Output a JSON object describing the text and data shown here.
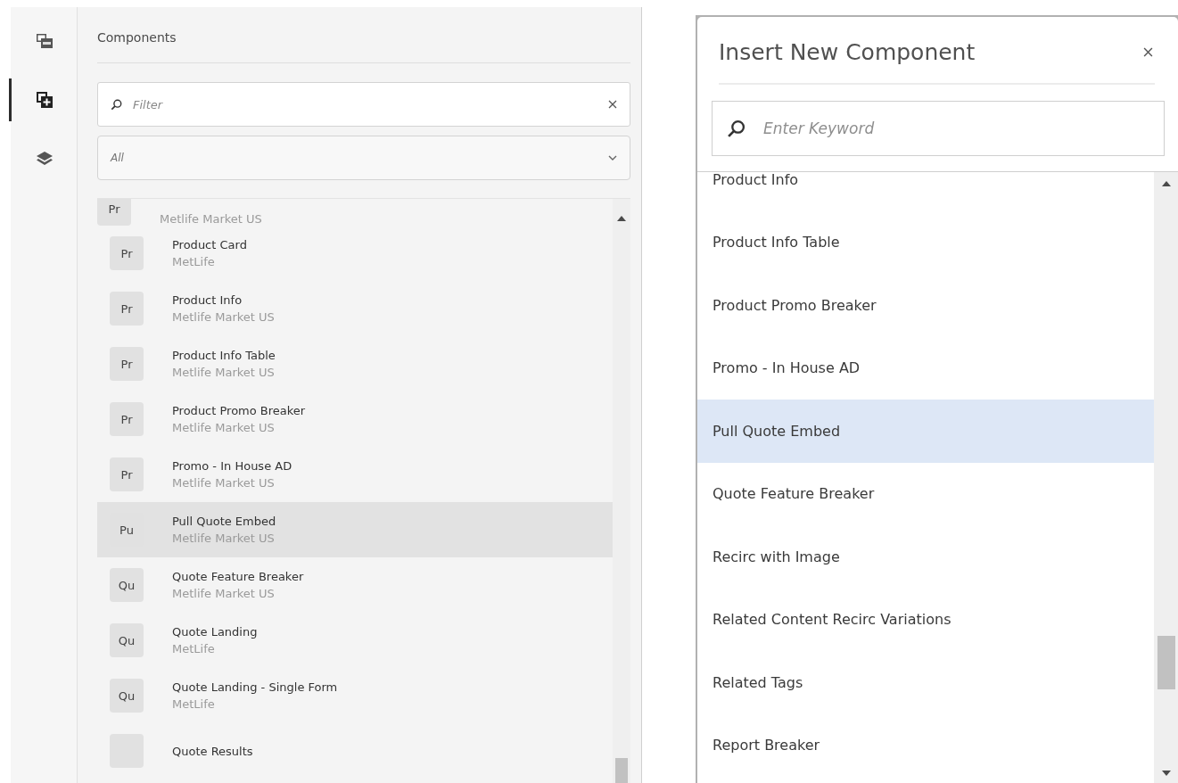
{
  "sidebar": {
    "rail": [
      {
        "kind": "assets",
        "selected": false
      },
      {
        "kind": "components",
        "selected": true
      },
      {
        "kind": "layers",
        "selected": false
      }
    ]
  },
  "components_panel": {
    "title": "Components",
    "filter": {
      "placeholder": "Filter"
    },
    "group_select": {
      "value": "All"
    },
    "items": [
      {
        "badge": "Pr",
        "subtitle": "Metlife Market US",
        "selected": false
      },
      {
        "badge": "Pr",
        "title": "Product Card",
        "subtitle": "MetLife",
        "selected": false
      },
      {
        "badge": "Pr",
        "title": "Product Info",
        "subtitle": "Metlife Market US",
        "selected": false
      },
      {
        "badge": "Pr",
        "title": "Product Info Table",
        "subtitle": "Metlife Market US",
        "selected": false
      },
      {
        "badge": "Pr",
        "title": "Product Promo Breaker",
        "subtitle": "Metlife Market US",
        "selected": false
      },
      {
        "badge": "Pr",
        "title": "Promo - In House AD",
        "subtitle": "Metlife Market US",
        "selected": false
      },
      {
        "badge": "Pu",
        "title": "Pull Quote Embed",
        "subtitle": "Metlife Market US",
        "selected": true
      },
      {
        "badge": "Qu",
        "title": "Quote Feature Breaker",
        "subtitle": "Metlife Market US",
        "selected": false
      },
      {
        "badge": "Qu",
        "title": "Quote Landing",
        "subtitle": "MetLife",
        "selected": false
      },
      {
        "badge": "Qu",
        "title": "Quote Landing - Single Form",
        "subtitle": "MetLife",
        "selected": false
      },
      {
        "title": "Quote Results",
        "selected": false
      }
    ]
  },
  "insert_dialog": {
    "title": "Insert New Component",
    "search": {
      "placeholder": "Enter Keyword"
    },
    "items": [
      {
        "label": "Product Info",
        "selected": false
      },
      {
        "label": "Product Info Table",
        "selected": false
      },
      {
        "label": "Product Promo Breaker",
        "selected": false
      },
      {
        "label": "Promo - In House AD",
        "selected": false
      },
      {
        "label": "Pull Quote Embed",
        "selected": true
      },
      {
        "label": "Quote Feature Breaker",
        "selected": false
      },
      {
        "label": "Recirc with Image",
        "selected": false
      },
      {
        "label": "Related Content Recirc Variations",
        "selected": false
      },
      {
        "label": "Related Tags",
        "selected": false
      },
      {
        "label": "Report Breaker",
        "selected": false
      }
    ]
  }
}
